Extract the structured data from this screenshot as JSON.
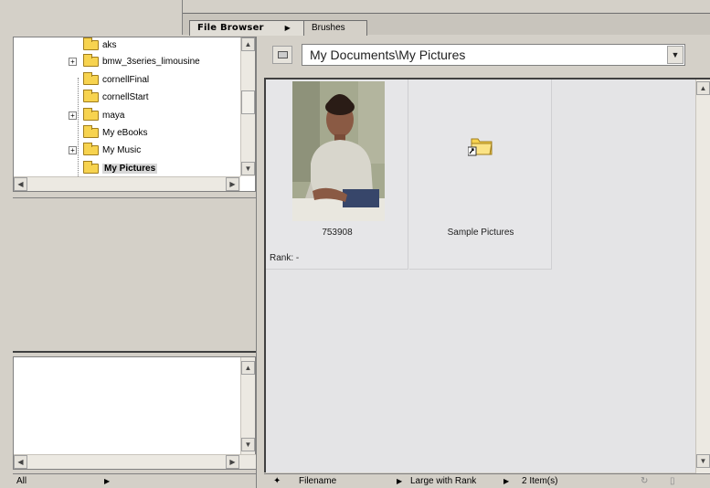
{
  "tabs": [
    {
      "label": "File Browser"
    },
    {
      "label": "Brushes"
    }
  ],
  "tree": {
    "items": [
      {
        "label": "aks",
        "expand": ""
      },
      {
        "label": "bmw_3series_limousine",
        "expand": "+"
      },
      {
        "label": "cornellFinal",
        "expand": ""
      },
      {
        "label": "cornellStart",
        "expand": ""
      },
      {
        "label": "maya",
        "expand": "+"
      },
      {
        "label": "My eBooks",
        "expand": ""
      },
      {
        "label": "My Music",
        "expand": "+"
      },
      {
        "label": "My Pictures",
        "expand": "",
        "selected": true
      }
    ]
  },
  "path": {
    "value": "My Documents\\My Pictures"
  },
  "thumbnails": [
    {
      "caption": "753908",
      "rank": "Rank:  -"
    },
    {
      "caption": "Sample Pictures"
    }
  ],
  "status_left": {
    "filter": "All"
  },
  "status_right": {
    "sort": "Filename",
    "view": "Large with Rank",
    "count": "2 Item(s)"
  },
  "colors": {
    "folder": "#f7d34f",
    "selection": "#d8d8d8",
    "browser_bg": "#e4e4e6"
  }
}
